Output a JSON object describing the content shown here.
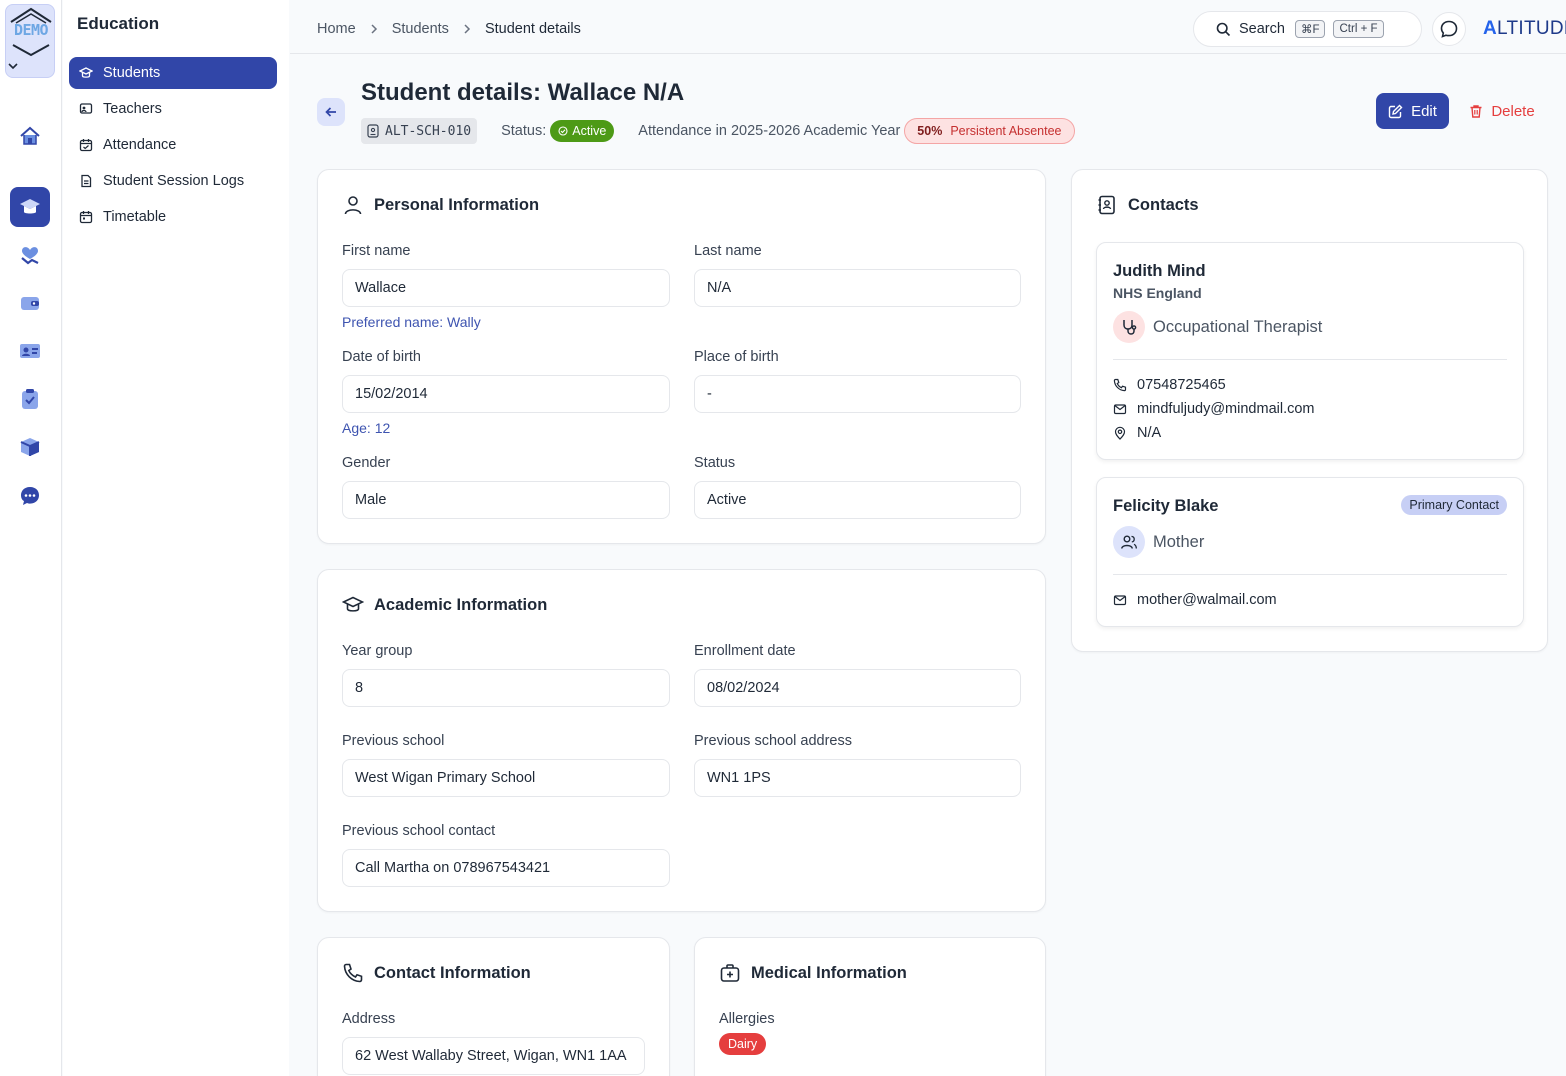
{
  "rail": {
    "logo_text": "DEMO",
    "icons": [
      "home-icon",
      "graduation-cap-icon",
      "handshake-heart-icon",
      "wallet-icon",
      "id-card-icon",
      "clipboard-check-icon",
      "box-icon",
      "chat-dots-icon"
    ]
  },
  "sidebar": {
    "title": "Education",
    "items": [
      {
        "label": "Students",
        "icon": "graduation-cap-icon",
        "active": true
      },
      {
        "label": "Teachers",
        "icon": "presentation-icon"
      },
      {
        "label": "Attendance",
        "icon": "calendar-check-icon"
      },
      {
        "label": "Student Session Logs",
        "icon": "document-icon"
      },
      {
        "label": "Timetable",
        "icon": "calendar-icon"
      }
    ]
  },
  "topbar": {
    "breadcrumb": [
      "Home",
      "Students",
      "Student details"
    ],
    "search_label": "Search",
    "shortcut_mac": "⌘F",
    "shortcut_win": "Ctrl + F",
    "brand": {
      "first": "A",
      "rest": "LTITUDE"
    }
  },
  "header": {
    "title": "Student details: Wallace N/A",
    "student_id": "ALT-SCH-010",
    "status_label": "Status:",
    "status_value": "Active",
    "attendance_label": "Attendance in 2025-2026 Academic Year",
    "attendance_pct": "50%",
    "attendance_flag": "Persistent Absentee",
    "edit_label": "Edit",
    "delete_label": "Delete"
  },
  "personal": {
    "title": "Personal Information",
    "first_name_label": "First name",
    "first_name": "Wallace",
    "preferred_name": "Preferred name: Wally",
    "last_name_label": "Last name",
    "last_name": "N/A",
    "dob_label": "Date of birth",
    "dob": "15/02/2014",
    "age": "Age: 12",
    "pob_label": "Place of birth",
    "pob": "-",
    "gender_label": "Gender",
    "gender": "Male",
    "status_label": "Status",
    "status": "Active"
  },
  "academic": {
    "title": "Academic Information",
    "year_group_label": "Year group",
    "year_group": "8",
    "enrollment_label": "Enrollment date",
    "enrollment": "08/02/2024",
    "prev_school_label": "Previous school",
    "prev_school": "West Wigan Primary School",
    "prev_address_label": "Previous school address",
    "prev_address": "WN1 1PS",
    "prev_contact_label": "Previous school contact",
    "prev_contact": "Call Martha on 078967543421"
  },
  "contact_info": {
    "title": "Contact Information",
    "address_label": "Address",
    "address": "62 West Wallaby Street, Wigan, WN1 1AA"
  },
  "medical": {
    "title": "Medical Information",
    "allergies_label": "Allergies",
    "allergies": [
      "Dairy"
    ]
  },
  "contacts": {
    "title": "Contacts",
    "items": [
      {
        "name": "Judith Mind",
        "organization": "NHS England",
        "role": "Occupational Therapist",
        "phone": "07548725465",
        "email": "mindfuljudy@mindmail.com",
        "address": "N/A"
      },
      {
        "name": "Felicity Blake",
        "badge": "Primary Contact",
        "role": "Mother",
        "email": "mother@walmail.com"
      }
    ]
  },
  "colors": {
    "accent": "#3146a8",
    "active_green": "#4d9a16",
    "danger": "#e53e3e",
    "hint_blue": "#3e54b0"
  }
}
